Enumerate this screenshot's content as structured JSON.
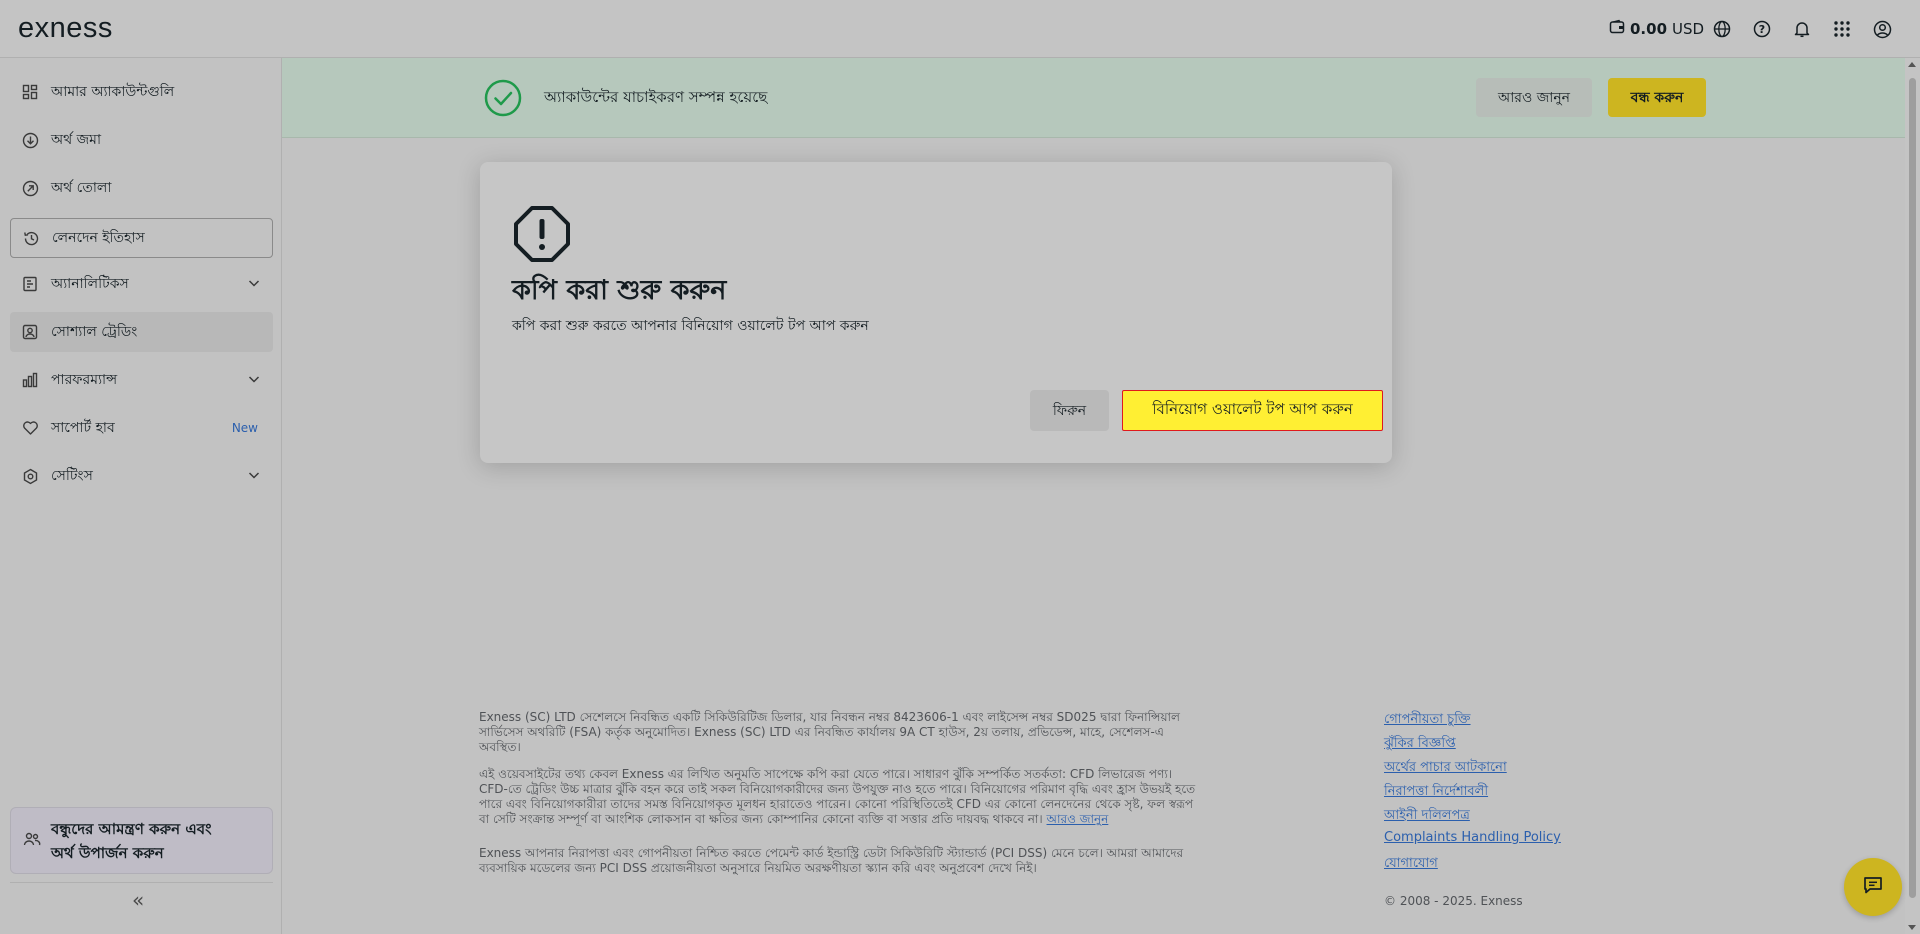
{
  "header": {
    "logo": "exness",
    "balance_amount": "0.00",
    "balance_currency": "USD",
    "icons": [
      "wallet-icon",
      "globe-icon",
      "help-icon",
      "bell-icon",
      "apps-grid-icon",
      "profile-icon"
    ]
  },
  "sidebar": {
    "items": [
      {
        "label": "আমার অ্যাকাউন্টগুলি",
        "icon": "accounts-grid-icon"
      },
      {
        "label": "অর্থ জমা",
        "icon": "deposit-icon"
      },
      {
        "label": "অর্থ তোলা",
        "icon": "withdraw-icon"
      },
      {
        "label": "লেনদেন ইতিহাস",
        "icon": "history-icon"
      },
      {
        "label": "অ্যানালিটিকস",
        "icon": "analytics-icon"
      },
      {
        "label": "সোশ্যাল ট্রেডিং",
        "icon": "social-trading-icon"
      },
      {
        "label": "পারফরম্যান্স",
        "icon": "performance-icon"
      },
      {
        "label": "সাপোর্ট হাব",
        "icon": "heart-icon",
        "badge": "New"
      },
      {
        "label": "সেটিংস",
        "icon": "settings-icon"
      }
    ],
    "invite_line1": "বন্ধুদের আমন্ত্রণ করুন এবং",
    "invite_line2": "অর্থ উপার্জন করুন",
    "collapse_symbol": "«"
  },
  "banner": {
    "message": "অ্যাকাউন্টের যাচাইকরণ সম্পন্ন হয়েছে",
    "learn_more": "আরও জানুন",
    "close": "বন্ধ করুন"
  },
  "modal": {
    "title": "কপি করা শুরু করুন",
    "subtitle": "কপি করা শুরু করতে আপনার বিনিয়োগ ওয়ালেট টপ আপ করুন",
    "back_button": "ফিরুন",
    "topup_button": "বিনিয়োগ ওয়ালেট টপ আপ করুন"
  },
  "footer": {
    "para1_line1": "Exness (SC) LTD সেশেলসে নিবন্ধিত একটি সিকিউরিটিজ ডিলার, যার নিবন্ধন নম্বর 8423606-1 এবং লাইসেন্স নম্বর SD025 দ্বারা ফিনান্সিয়াল",
    "para1_line2": "সার্ভিসেস অথরিটি (FSA) কর্তৃক অনুমোদিত। Exness (SC) LTD এর নিবন্ধিত কার্যালয় 9A CT হাউস, 2য় তলায়, প্রভিডেন্স, মাহে, সেশেলস-এ",
    "para1_line3": "অবস্থিত।",
    "para2_line1": "এই ওয়েবসাইটের তথ্য কেবল Exness এর লিখিত অনুমতি সাপেক্ষে কপি করা যেতে পারে। সাধারণ ঝুঁকি সম্পর্কিত সতর্কতা: CFD লিভারেজ পণ্য।",
    "para2_line2": "CFD-তে ট্রেডিং উচ্চ মাত্রার ঝুঁকি বহন করে তাই সকল বিনিয়োগকারীদের জন্য উপযুক্ত নাও হতে পারে। বিনিয়োগের পরিমাণ বৃদ্ধি এবং হ্রাস উভয়ই হতে",
    "para2_line3": "পারে এবং বিনিয়োগকারীরা তাদের সমস্ত বিনিয়োগকৃত মূলধন হারাতেও পারেন। কোনো পরিস্থিতিতেই CFD এর কোনো লেনদেনের থেকে সৃষ্ট, ফল স্বরূপ",
    "para2_line4": "বা সেটি সংক্রান্ত সম্পূর্ণ বা আংশিক লোকসান বা ক্ষতির জন্য কোম্পানির কোনো ব্যক্তি বা সত্তার প্রতি দায়বদ্ধ থাকবে না।",
    "para2_link": "আরও জানুন",
    "para3_line1": "Exness আপনার নিরাপত্তা এবং গোপনীয়তা নিশ্চিত করতে পেমেন্ট কার্ড ইন্ডাস্ট্রি ডেটা সিকিউরিটি স্ট্যান্ডার্ড (PCI DSS) মেনে চলে। আমরা আমাদের",
    "para3_line2": "ব্যবসায়িক মডেলের জন্য PCI DSS প্রয়োজনীয়তা অনুসারে নিয়মিত অরক্ষণীয়তা স্ক্যান করি এবং অনুপ্রবেশ দেখে নিই।",
    "links": [
      "গোপনীয়তা চুক্তি",
      "ঝুঁকির বিজ্ঞপ্তি",
      "অর্থের পাচার আটকানো",
      "নিরাপত্তা নির্দেশাবলী",
      "আইনী দলিলপত্র",
      "Complaints Handling Policy",
      "যোগাযোগ"
    ],
    "copyright": "© 2008 - 2025. Exness"
  },
  "colors": {
    "accent_yellow": "#ffde02",
    "highlight_yellow": "#ffef33",
    "highlight_border": "#e0191c",
    "success_green": "#1f9a4a",
    "link_blue": "#2b5fad"
  }
}
